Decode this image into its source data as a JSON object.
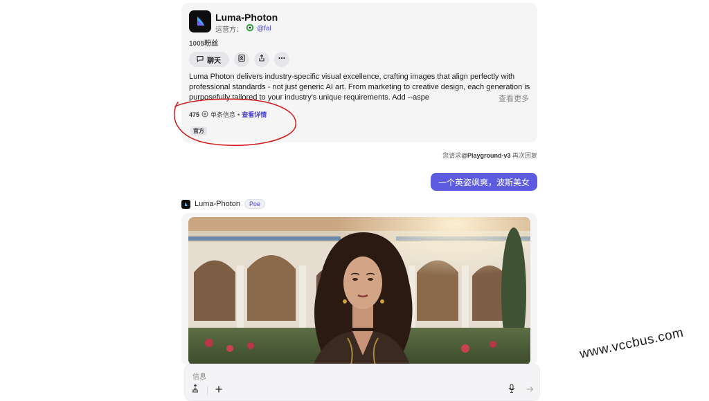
{
  "bot_card": {
    "name": "Luma-Photon",
    "operator_label": "运营方：",
    "operator_handle": "@fal",
    "followers": "1005粉丝",
    "chat_label": "聊天",
    "description": "Luma Photon delivers industry-specific visual excellence, crafting images that align perfectly with professional standards - not just generic AI art. From marketing to creative design, each generation is purposefully tailored to your industry's unique requirements. Add --aspe",
    "more_label": "查看更多",
    "stats_count": "475",
    "stats_unit": "单条信息",
    "stats_dot": "•",
    "stats_link": "查看详情",
    "official_badge": "官方"
  },
  "conversation": {
    "hint_prefix": "您请求",
    "hint_bot": "@Playground-v3",
    "hint_suffix": " 再次回复",
    "user_message": "一个英姿飒爽，波斯美女",
    "reply_bot_name": "Luma-Photon",
    "reply_badge": "Poe"
  },
  "composer": {
    "placeholder": "信息"
  },
  "watermark": "www.vccbus.com",
  "colors": {
    "accent": "#5d5ce0",
    "annotation": "#d21f1f",
    "card_bg": "#f5f5f6"
  },
  "icons": [
    "chat-icon",
    "add-to-profile-icon",
    "share-icon",
    "more-icon",
    "plus-circle-icon",
    "microphone-icon",
    "send-icon",
    "tools-icon",
    "add-icon"
  ]
}
